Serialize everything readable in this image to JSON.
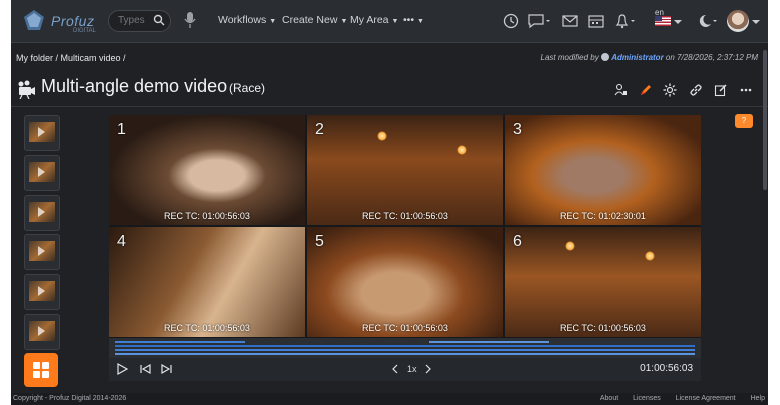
{
  "header": {
    "logo_text": "Profuz",
    "logo_sub": "DIGITAL",
    "search_placeholder": "Types",
    "nav": [
      {
        "label": "Workflows"
      },
      {
        "label": "Create New"
      },
      {
        "label": "My Area"
      },
      {
        "label": "•••"
      }
    ],
    "language": "en",
    "icons": [
      "history-icon",
      "chat-icon",
      "mail-icon",
      "calendar-icon",
      "bell-icon",
      "flag-icon",
      "moon-icon",
      "avatar"
    ]
  },
  "breadcrumb": {
    "path": "My folder  /  Multicam video  /",
    "modified_prefix": "Last modified by",
    "modified_user": "Administrator",
    "modified_suffix": "on 7/28/2026, 2:37:12 PM"
  },
  "page": {
    "title": "Multi-angle demo video",
    "subtitle": "(Race)"
  },
  "player": {
    "cells": [
      {
        "num": "1",
        "tc": "REC TC: 01:00:56:03"
      },
      {
        "num": "2",
        "tc": "REC TC: 01:00:56:03"
      },
      {
        "num": "3",
        "tc": "REC TC: 01:02:30:01"
      },
      {
        "num": "4",
        "tc": "REC TC: 01:00:56:03"
      },
      {
        "num": "5",
        "tc": "REC TC: 01:00:56:03"
      },
      {
        "num": "6",
        "tc": "REC TC: 01:00:56:03"
      }
    ],
    "speed": "1x",
    "current_time": "01:00:56:03"
  },
  "help_badge": "?",
  "footer": {
    "copyright": "Copyright - Profuz Digital 2014-2026",
    "links": [
      "About",
      "Licenses",
      "License Agreement",
      "Help"
    ]
  },
  "colors": {
    "accent": "#ff7a1a",
    "link": "#6ea8ff",
    "timeline": "#3f7fd6"
  }
}
